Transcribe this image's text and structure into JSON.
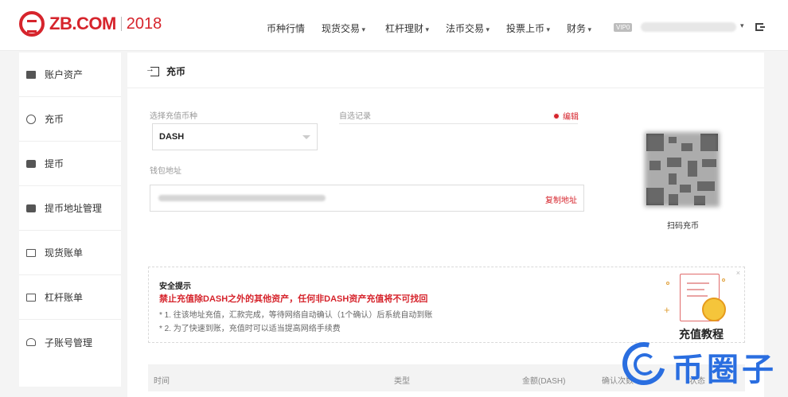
{
  "header": {
    "logo_text": "ZB.COM",
    "logo_year": "2018",
    "nav": [
      {
        "label": "币种行情",
        "dropdown": false
      },
      {
        "label": "现货交易",
        "dropdown": true
      },
      {
        "label": "杠杆理财",
        "dropdown": true
      },
      {
        "label": "法币交易",
        "dropdown": true
      },
      {
        "label": "投票上币",
        "dropdown": true
      },
      {
        "label": "财务",
        "dropdown": true
      }
    ],
    "vip_label": "VIP0"
  },
  "sidebar": {
    "items": [
      {
        "label": "账户资产",
        "icon": "wallet-icon"
      },
      {
        "label": "充币",
        "icon": "deposit-icon"
      },
      {
        "label": "提币",
        "icon": "withdraw-icon"
      },
      {
        "label": "提币地址管理",
        "icon": "address-card-icon"
      },
      {
        "label": "现货账单",
        "icon": "spot-bill-icon"
      },
      {
        "label": "杠杆账单",
        "icon": "margin-bill-icon"
      },
      {
        "label": "子账号管理",
        "icon": "sub-account-icon"
      }
    ]
  },
  "main": {
    "title": "充币",
    "select_label": "选择充值币种",
    "selected_coin": "DASH",
    "auto_label": "自选记录",
    "edit_label": "编辑",
    "wallet_label": "钱包地址",
    "copy_label": "复制地址",
    "qr_caption": "扫码充币",
    "notice": {
      "title": "安全提示",
      "warning": "禁止充值除DASH之外的其他资产，任何非DASH资产充值将不可找回",
      "lines": [
        "* 1. 往该地址充值，汇款完成，等待网络自动确认（1个确认）后系统自动到账",
        "* 2. 为了快速到账，充值时可以适当提高网络手续费"
      ],
      "close": "×"
    },
    "tutorial_label": "充值教程",
    "table_headers": [
      "时间",
      "类型",
      "金额(DASH)",
      "确认次数",
      "状态"
    ]
  },
  "watermark": {
    "text": "币圈子"
  },
  "colors": {
    "brand_red": "#d6242c",
    "watermark_blue": "#2a6ee0"
  }
}
